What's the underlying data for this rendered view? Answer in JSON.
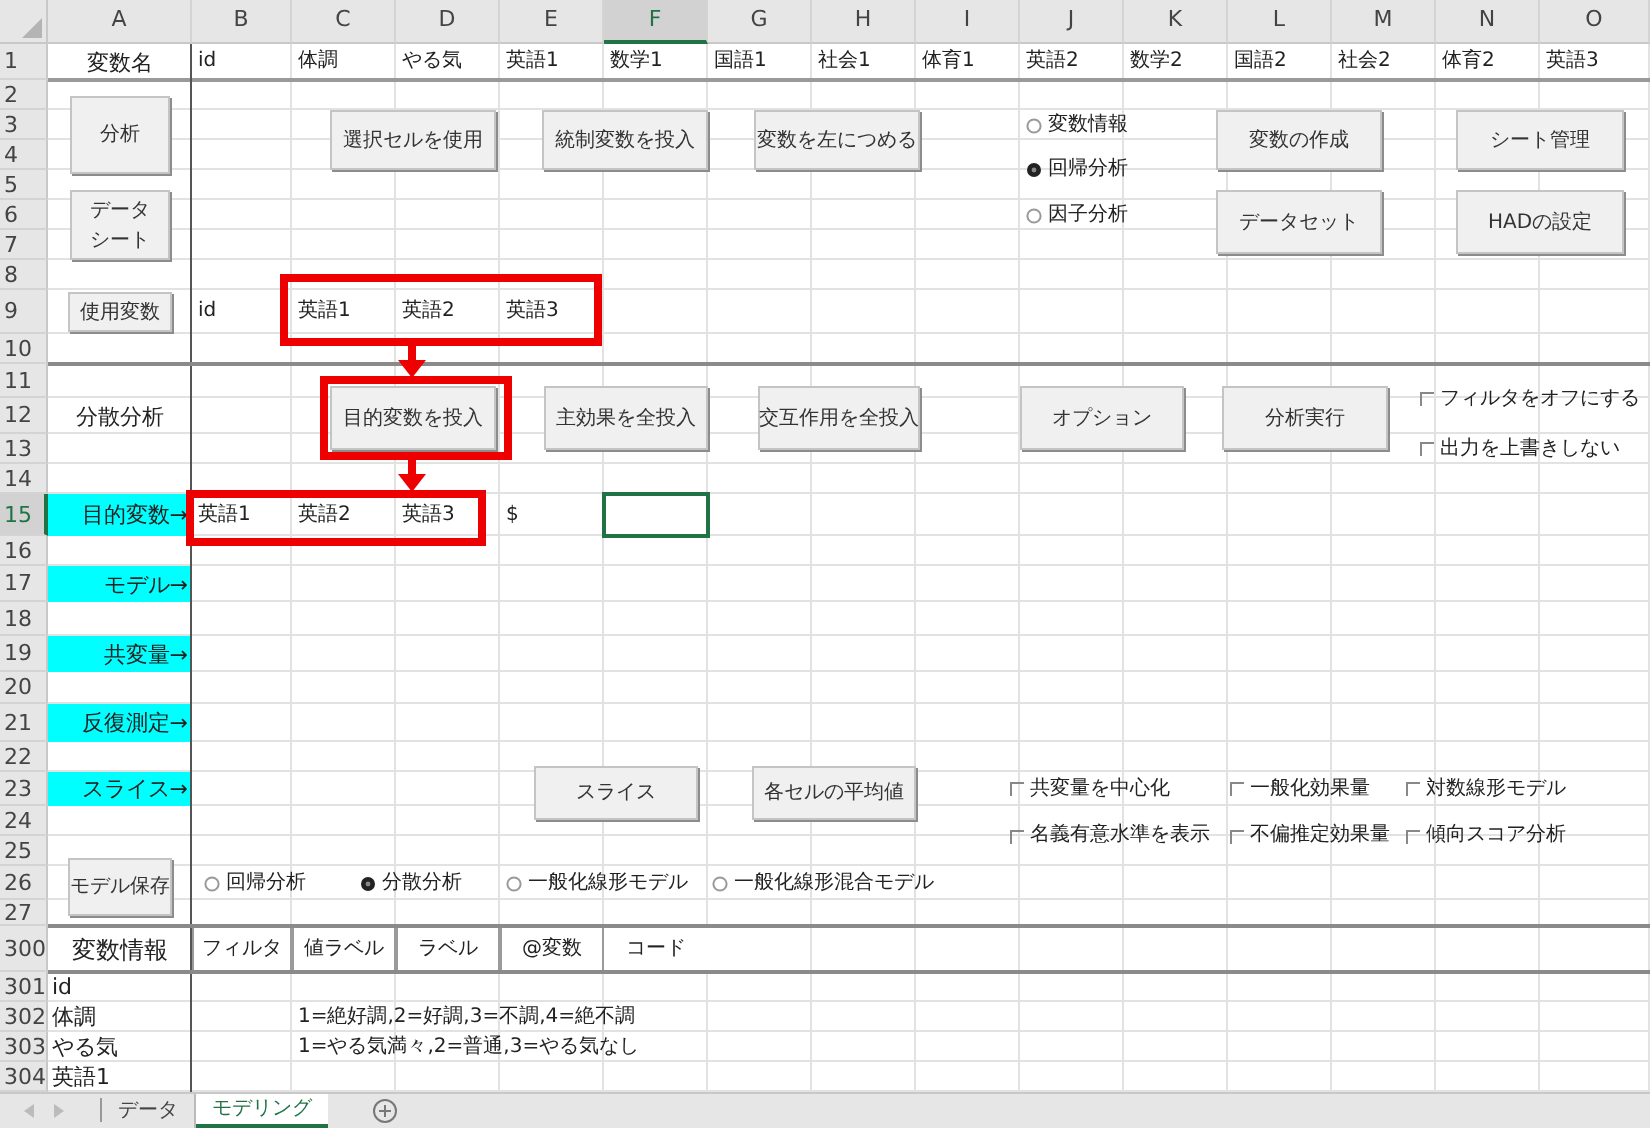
{
  "columns": [
    {
      "label": "A",
      "selected": false
    },
    {
      "label": "B",
      "selected": false
    },
    {
      "label": "C",
      "selected": false
    },
    {
      "label": "D",
      "selected": false
    },
    {
      "label": "E",
      "selected": false
    },
    {
      "label": "F",
      "selected": true
    },
    {
      "label": "G",
      "selected": false
    },
    {
      "label": "H",
      "selected": false
    },
    {
      "label": "I",
      "selected": false
    },
    {
      "label": "J",
      "selected": false
    },
    {
      "label": "K",
      "selected": false
    },
    {
      "label": "L",
      "selected": false
    },
    {
      "label": "M",
      "selected": false
    },
    {
      "label": "N",
      "selected": false
    },
    {
      "label": "O",
      "selected": false
    }
  ],
  "rows": [
    {
      "label": "1",
      "selected": false,
      "cells": {
        "A": {
          "text": "変数名",
          "highlighted": false
        },
        "B": {
          "text": "id",
          "highlighted": false
        },
        "C": {
          "text": "体調",
          "highlighted": false
        },
        "D": {
          "text": "やる気",
          "highlighted": false
        },
        "E": {
          "text": "英語1",
          "highlighted": false
        },
        "F": {
          "text": "数学1",
          "highlighted": false
        },
        "G": {
          "text": "国語1",
          "highlighted": false
        },
        "H": {
          "text": "社会1",
          "highlighted": false
        },
        "I": {
          "text": "体育1",
          "highlighted": false
        },
        "J": {
          "text": "英語2",
          "highlighted": false
        },
        "K": {
          "text": "数学2",
          "highlighted": false
        },
        "L": {
          "text": "国語2",
          "highlighted": false
        },
        "M": {
          "text": "社会2",
          "highlighted": false
        },
        "N": {
          "text": "体育2",
          "highlighted": false
        },
        "O": {
          "text": "英語3",
          "highlighted": false
        }
      }
    },
    {
      "label": "2",
      "selected": false
    },
    {
      "label": "3",
      "selected": false
    },
    {
      "label": "4",
      "selected": false
    },
    {
      "label": "5",
      "selected": false
    },
    {
      "label": "6",
      "selected": false
    },
    {
      "label": "7",
      "selected": false
    },
    {
      "label": "8",
      "selected": false
    },
    {
      "label": "9",
      "selected": false,
      "cells": {
        "B": {
          "text": "id",
          "highlighted": false
        },
        "C": {
          "text": "英語1",
          "highlighted": false
        },
        "D": {
          "text": "英語2",
          "highlighted": false
        },
        "E": {
          "text": "英語3",
          "highlighted": false
        }
      }
    },
    {
      "label": "10",
      "selected": false
    },
    {
      "label": "11",
      "selected": false
    },
    {
      "label": "12",
      "selected": false,
      "cells": {
        "A": {
          "text": "分散分析",
          "highlighted": false
        }
      }
    },
    {
      "label": "13",
      "selected": false
    },
    {
      "label": "14",
      "selected": false
    },
    {
      "label": "15",
      "selected": true,
      "cells": {
        "A": {
          "text": "目的変数→",
          "highlighted": true
        },
        "B": {
          "text": "英語1",
          "highlighted": false
        },
        "C": {
          "text": "英語2",
          "highlighted": false
        },
        "D": {
          "text": "英語3",
          "highlighted": false
        },
        "E": {
          "text": "$",
          "highlighted": false
        }
      }
    },
    {
      "label": "16",
      "selected": false
    },
    {
      "label": "17",
      "selected": false,
      "cells": {
        "A": {
          "text": "モデル→",
          "highlighted": true
        }
      }
    },
    {
      "label": "18",
      "selected": false
    },
    {
      "label": "19",
      "selected": false,
      "cells": {
        "A": {
          "text": "共変量→",
          "highlighted": true
        }
      }
    },
    {
      "label": "20",
      "selected": false
    },
    {
      "label": "21",
      "selected": false,
      "cells": {
        "A": {
          "text": "反復測定→",
          "highlighted": true
        }
      }
    },
    {
      "label": "22",
      "selected": false
    },
    {
      "label": "23",
      "selected": false,
      "cells": {
        "A": {
          "text": "スライス→",
          "highlighted": true
        }
      }
    },
    {
      "label": "24",
      "selected": false
    },
    {
      "label": "25",
      "selected": false
    },
    {
      "label": "26",
      "selected": false
    },
    {
      "label": "27",
      "selected": false
    },
    {
      "label": "300",
      "selected": false,
      "cells": {
        "A": {
          "text": "変数情報",
          "highlighted": false
        }
      }
    },
    {
      "label": "301",
      "selected": false,
      "cells": {
        "A": {
          "text": "id",
          "highlighted": false
        }
      }
    },
    {
      "label": "302",
      "selected": false,
      "cells": {
        "A": {
          "text": "体調",
          "highlighted": false
        },
        "C": {
          "text": "1=絶好調,2=好調,3=不調,4=絶不調",
          "highlighted": false
        }
      }
    },
    {
      "label": "303",
      "selected": false,
      "cells": {
        "A": {
          "text": "やる気",
          "highlighted": false
        },
        "C": {
          "text": "1=やる気満々,2=普通,3=やる気なし",
          "highlighted": false
        }
      }
    },
    {
      "label": "304",
      "selected": false,
      "cells": {
        "A": {
          "text": "英語1",
          "highlighted": false
        }
      }
    }
  ],
  "buttons": [
    "分析",
    "データシート",
    "使用変数",
    "選択セルを使用",
    "統制変数を投入",
    "変数を左につめる",
    "変数の作成",
    "データセット",
    "シート管理",
    "HADの設定",
    "目的変数を投入",
    "主効果を全投入",
    "交互作用を全投入",
    "オプション",
    "分析実行",
    "スライス",
    "各セルの平均値",
    "モデル保存"
  ],
  "radio_groups": [
    {
      "options": [
        {
          "label": "変数情報",
          "selected": false
        },
        {
          "label": "回帰分析",
          "selected": true
        },
        {
          "label": "因子分析",
          "selected": false
        }
      ]
    },
    {
      "options": [
        {
          "label": "回帰分析",
          "selected": false
        },
        {
          "label": "分散分析",
          "selected": true
        },
        {
          "label": "一般化線形モデル",
          "selected": false
        },
        {
          "label": "一般化線形混合モデル",
          "selected": false
        }
      ]
    }
  ],
  "checkboxes": [
    {
      "label": "フィルタをオフにする",
      "checked": false
    },
    {
      "label": "出力を上書きしない",
      "checked": false
    },
    {
      "label": "共変量を中心化",
      "checked": false
    },
    {
      "label": "一般化効果量",
      "checked": false
    },
    {
      "label": "対数線形モデル",
      "checked": false
    },
    {
      "label": "名義有意水準を表示",
      "checked": false
    },
    {
      "label": "不偏推定効果量",
      "checked": false
    },
    {
      "label": "傾向スコア分析",
      "checked": false
    }
  ],
  "info_tabs": [
    {
      "label": "フィルタ",
      "selected": false
    },
    {
      "label": "値ラベル",
      "selected": false
    },
    {
      "label": "ラベル",
      "selected": false
    },
    {
      "label": "@変数",
      "selected": false
    },
    {
      "label": "コード",
      "selected": true
    }
  ],
  "sheet_tabs": [
    {
      "label": "データ",
      "selected": false
    },
    {
      "label": "モデリング",
      "selected": true
    }
  ]
}
